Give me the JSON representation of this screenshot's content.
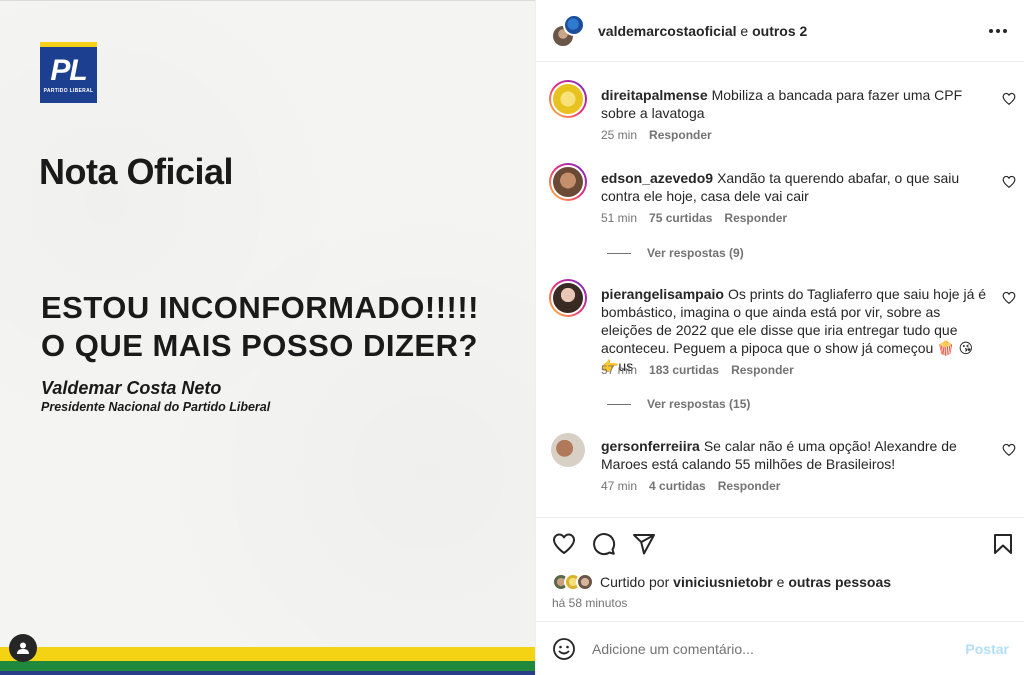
{
  "post": {
    "logo_text": "PL",
    "logo_subtext": "PARTIDO LIBERAL",
    "headline": "Nota Oficial",
    "quote_line1": "ESTOU INCONFORMADO!!!!!",
    "quote_line2": "O QUE MAIS POSSO DIZER?",
    "signature_name": "Valdemar Costa Neto",
    "signature_role": "Presidente Nacional do Partido Liberal"
  },
  "header": {
    "username": "valdemarcostaoficial",
    "connector": "e",
    "others": "outros 2"
  },
  "comments": [
    {
      "user": "direitapalmense",
      "text": "Mobiliza a bancada para fazer uma CPF sobre a lavatoga",
      "time": "25 min",
      "likes": "",
      "reply": "Responder",
      "view_replies": ""
    },
    {
      "user": "edson_azevedo9",
      "text": "Xandão ta querendo abafar, o que saiu contra ele hoje, casa dele vai cair",
      "time": "51 min",
      "likes": "75 curtidas",
      "reply": "Responder",
      "view_replies": "Ver respostas (9)"
    },
    {
      "user": "pierangelisampaio",
      "text": "Os prints do Tagliaferro que saiu hoje já é bombástico, imagina o que ainda está por vir, sobre as eleições de 2022 que ele disse que iria entregar tudo que aconteceu. Peguem a pipoca que o show já começou 🍿 😘 👉us",
      "time": "57 min",
      "likes": "183 curtidas",
      "reply": "Responder",
      "view_replies": "Ver respostas (15)"
    },
    {
      "user": "gersonferreiira",
      "text": "Se calar não é uma opção! Alexandre de Maroes está calando 55 milhões de Brasileiros!",
      "time": "47 min",
      "likes": "4 curtidas",
      "reply": "Responder",
      "view_replies": ""
    }
  ],
  "liked_by": {
    "prefix": "Curtido por",
    "user": "viniciusnietobr",
    "connector": "e",
    "others": "outras pessoas"
  },
  "time_ago": "há 58 minutos",
  "add_comment": {
    "placeholder": "Adicione um comentário...",
    "post_label": "Postar"
  },
  "colors": {
    "pl_blue": "#1d3f8f",
    "brazil_yellow": "#f3d313",
    "brazil_green": "#1f8a3c",
    "post_button_disabled": "#b2dffc"
  },
  "icons": {
    "more": "more-horizontal-icon",
    "like": "heart-icon",
    "comment": "comment-bubble-icon",
    "share": "paper-plane-icon",
    "save": "bookmark-icon",
    "emoji": "emoji-smile-icon",
    "tag_user": "user-tag-icon"
  }
}
